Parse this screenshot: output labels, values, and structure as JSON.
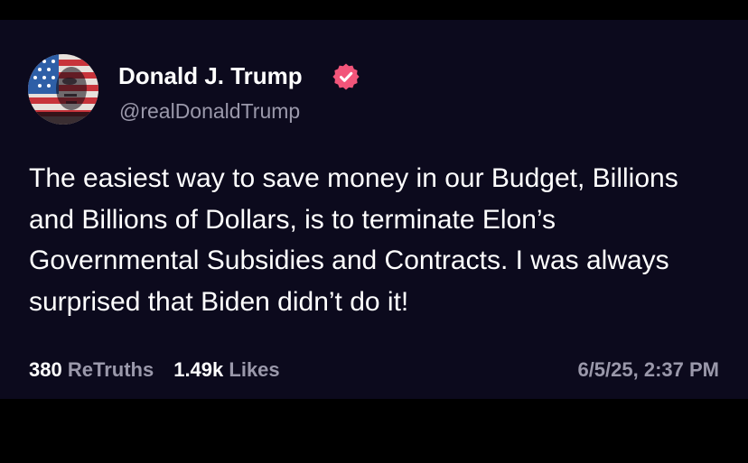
{
  "post": {
    "display_name": "Donald J. Trump",
    "handle": "@realDonaldTrump",
    "verified_icon": "verified-badge-icon",
    "text": "The easiest way to save money in our Budget, Billions and Billions of Dollars, is to terminate Elon’s Governmental Subsidies and Contracts. I was always surprised that Biden didn’t do it!",
    "retruths_count": "380",
    "retruths_label": "ReTruths",
    "likes_count": "1.49k",
    "likes_label": "Likes",
    "timestamp": "6/5/25, 2:37 PM"
  },
  "colors": {
    "background": "#0c0a1d",
    "text": "#ffffff",
    "muted": "#9a98aa",
    "verified": "#f2557a"
  }
}
